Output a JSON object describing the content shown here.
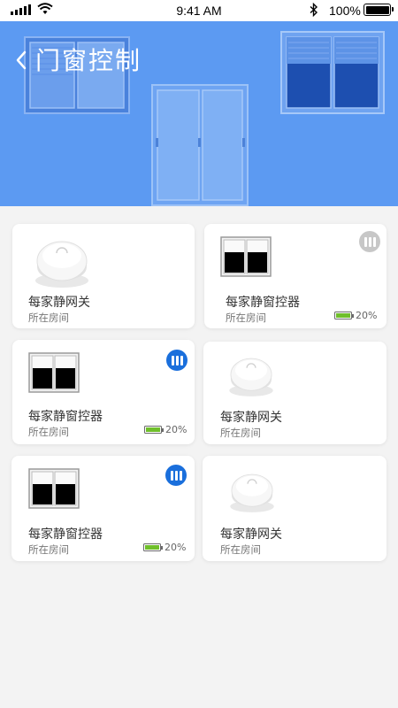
{
  "status_bar": {
    "time": "9:41 AM",
    "battery": "100%"
  },
  "header": {
    "title": "门窗控制"
  },
  "colors": {
    "header_bg": "#5c9af2",
    "badge_active": "#1a6fdc",
    "badge_inactive": "#c7c7c7",
    "battery_fill": "#6fbf2a"
  },
  "devices": [
    {
      "type": "gateway",
      "name": "每家静网关",
      "room": "所在房间"
    },
    {
      "type": "controller",
      "name": "每家静窗控器",
      "room": "所在房间",
      "battery": "20%",
      "badge": "inactive"
    },
    {
      "type": "controller",
      "name": "每家静窗控器",
      "room": "所在房间",
      "battery": "20%",
      "badge": "active"
    },
    {
      "type": "gateway",
      "name": "每家静网关",
      "room": "所在房间"
    },
    {
      "type": "controller",
      "name": "每家静窗控器",
      "room": "所在房间",
      "battery": "20%",
      "badge": "active"
    },
    {
      "type": "gateway",
      "name": "每家静网关",
      "room": "所在房间"
    }
  ]
}
